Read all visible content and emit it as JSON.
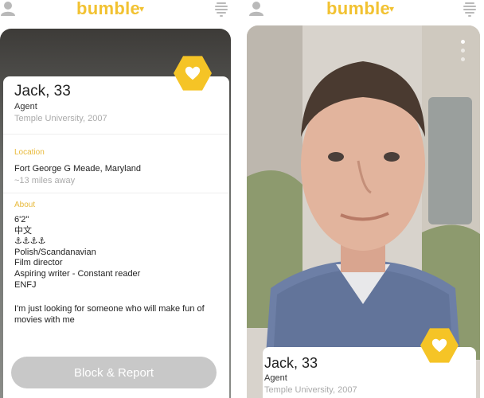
{
  "app": {
    "brand": "bumble",
    "brand_caret": "▾"
  },
  "profile": {
    "name_age": "Jack, 33",
    "job": "Agent",
    "school": "Temple University, 2007"
  },
  "location": {
    "title": "Location",
    "place": "Fort George G Meade, Maryland",
    "distance": "~13 miles away"
  },
  "about": {
    "title": "About",
    "lines": [
      "6'2\"",
      "中文",
      "⚓⚓⚓⚓",
      "Polish/Scandanavian",
      "Film director",
      "Aspiring writer - Constant reader",
      "ENFJ"
    ],
    "bio": "I'm just looking for someone who will make fun of movies with me"
  },
  "actions": {
    "block_report": "Block & Report"
  },
  "colors": {
    "accent": "#f5c426",
    "button_gray": "#c8c8c8",
    "section_title": "#e8b93a"
  },
  "icons": [
    "user-icon",
    "filter-icon",
    "heart-icon"
  ]
}
